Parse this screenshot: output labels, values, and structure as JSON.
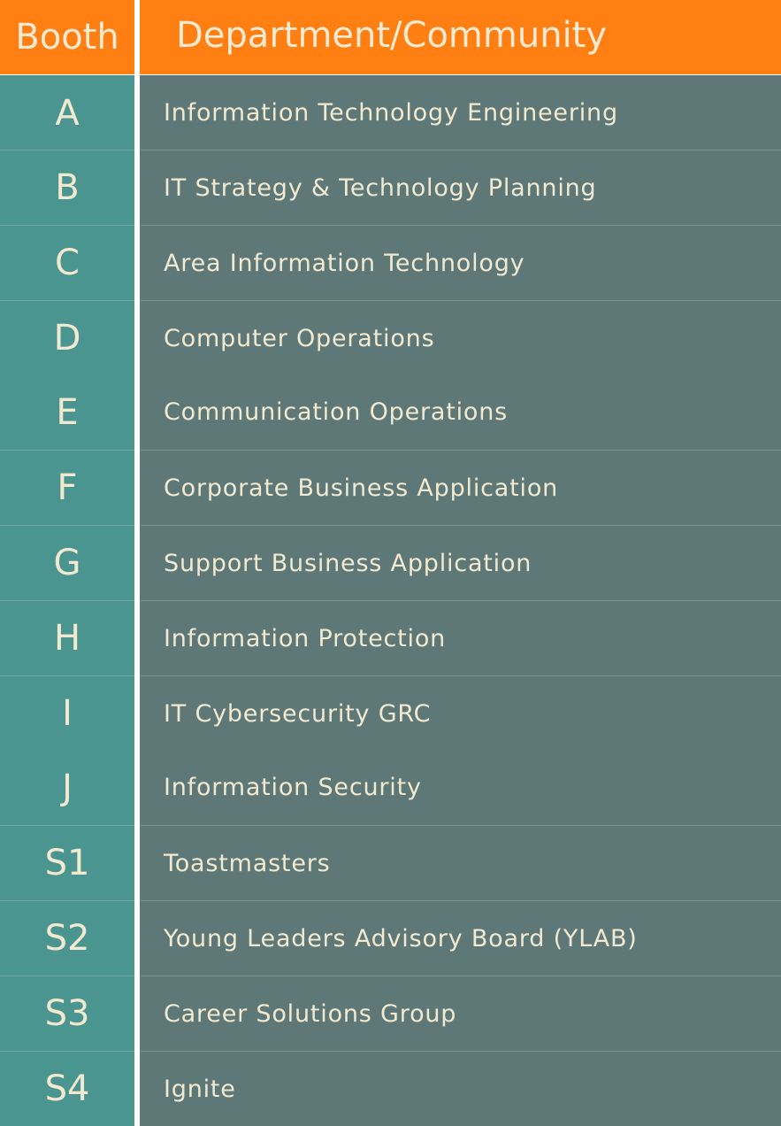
{
  "header": {
    "booth": "Booth",
    "department": "Department/Community"
  },
  "rows": [
    {
      "booth": "A",
      "department": "Information Technology Engineering"
    },
    {
      "booth": "B",
      "department": "IT Strategy & Technology Planning"
    },
    {
      "booth": "C",
      "department": "Area Information Technology"
    },
    {
      "booth": "D",
      "department": "Computer Operations"
    },
    {
      "booth": "E",
      "department": "Communication Operations"
    },
    {
      "booth": "F",
      "department": "Corporate Business Application"
    },
    {
      "booth": "G",
      "department": "Support Business Application"
    },
    {
      "booth": "H",
      "department": "Information Protection"
    },
    {
      "booth": "I",
      "department": "IT Cybersecurity GRC"
    },
    {
      "booth": "J",
      "department": "Information Security"
    },
    {
      "booth": "S1",
      "department": "Toastmasters"
    },
    {
      "booth": "S2",
      "department": "Young Leaders Advisory Board (YLAB)"
    },
    {
      "booth": "S3",
      "department": "Career Solutions Group"
    },
    {
      "booth": "S4",
      "department": "Ignite"
    }
  ],
  "colors": {
    "header": "#ff7f12",
    "booth_column": "#4b9590",
    "department_column": "#5e7877",
    "text": "#f1ead0"
  }
}
